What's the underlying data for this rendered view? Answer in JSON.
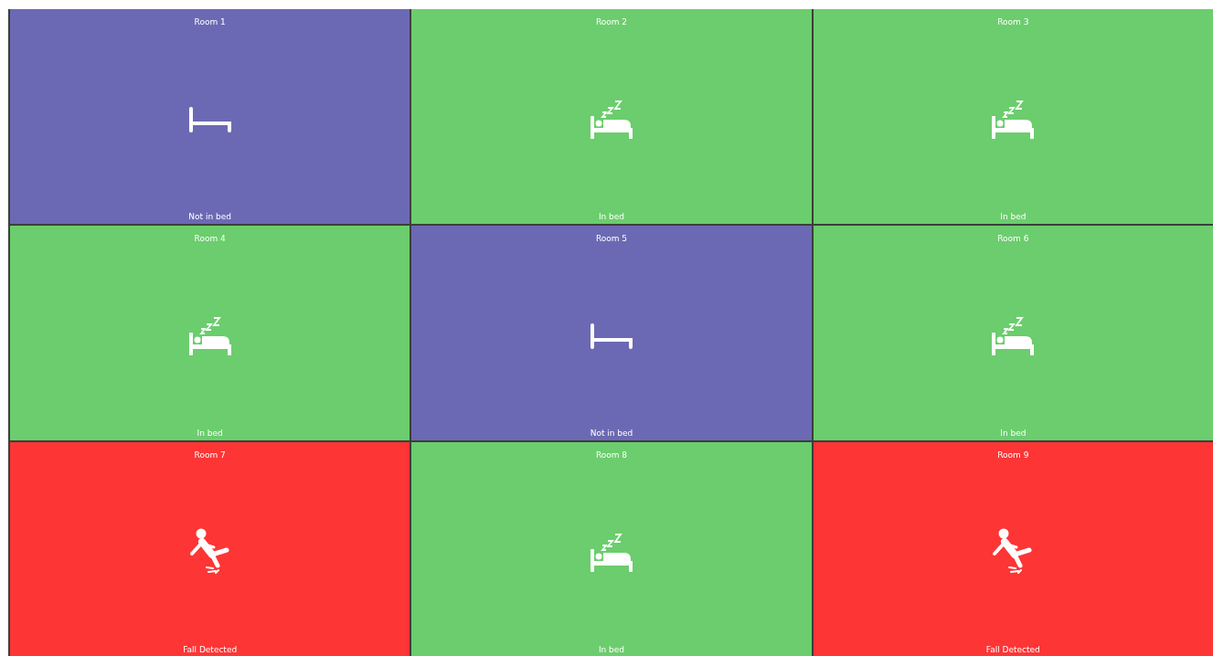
{
  "rooms": [
    {
      "name": "Room 1",
      "kind": "empty",
      "status": "Not in bed"
    },
    {
      "name": "Room 2",
      "kind": "sleeping",
      "status": "In bed"
    },
    {
      "name": "Room 3",
      "kind": "sleeping",
      "status": "In bed"
    },
    {
      "name": "Room 4",
      "kind": "sleeping",
      "status": "In bed"
    },
    {
      "name": "Room 5",
      "kind": "empty",
      "status": "Not in bed"
    },
    {
      "name": "Room 6",
      "kind": "sleeping",
      "status": "In bed"
    },
    {
      "name": "Room 7",
      "kind": "fall",
      "status": "Fall Detected"
    },
    {
      "name": "Room 8",
      "kind": "sleeping",
      "status": "In bed"
    },
    {
      "name": "Room 9",
      "kind": "fall",
      "status": "Fall Detected"
    }
  ]
}
